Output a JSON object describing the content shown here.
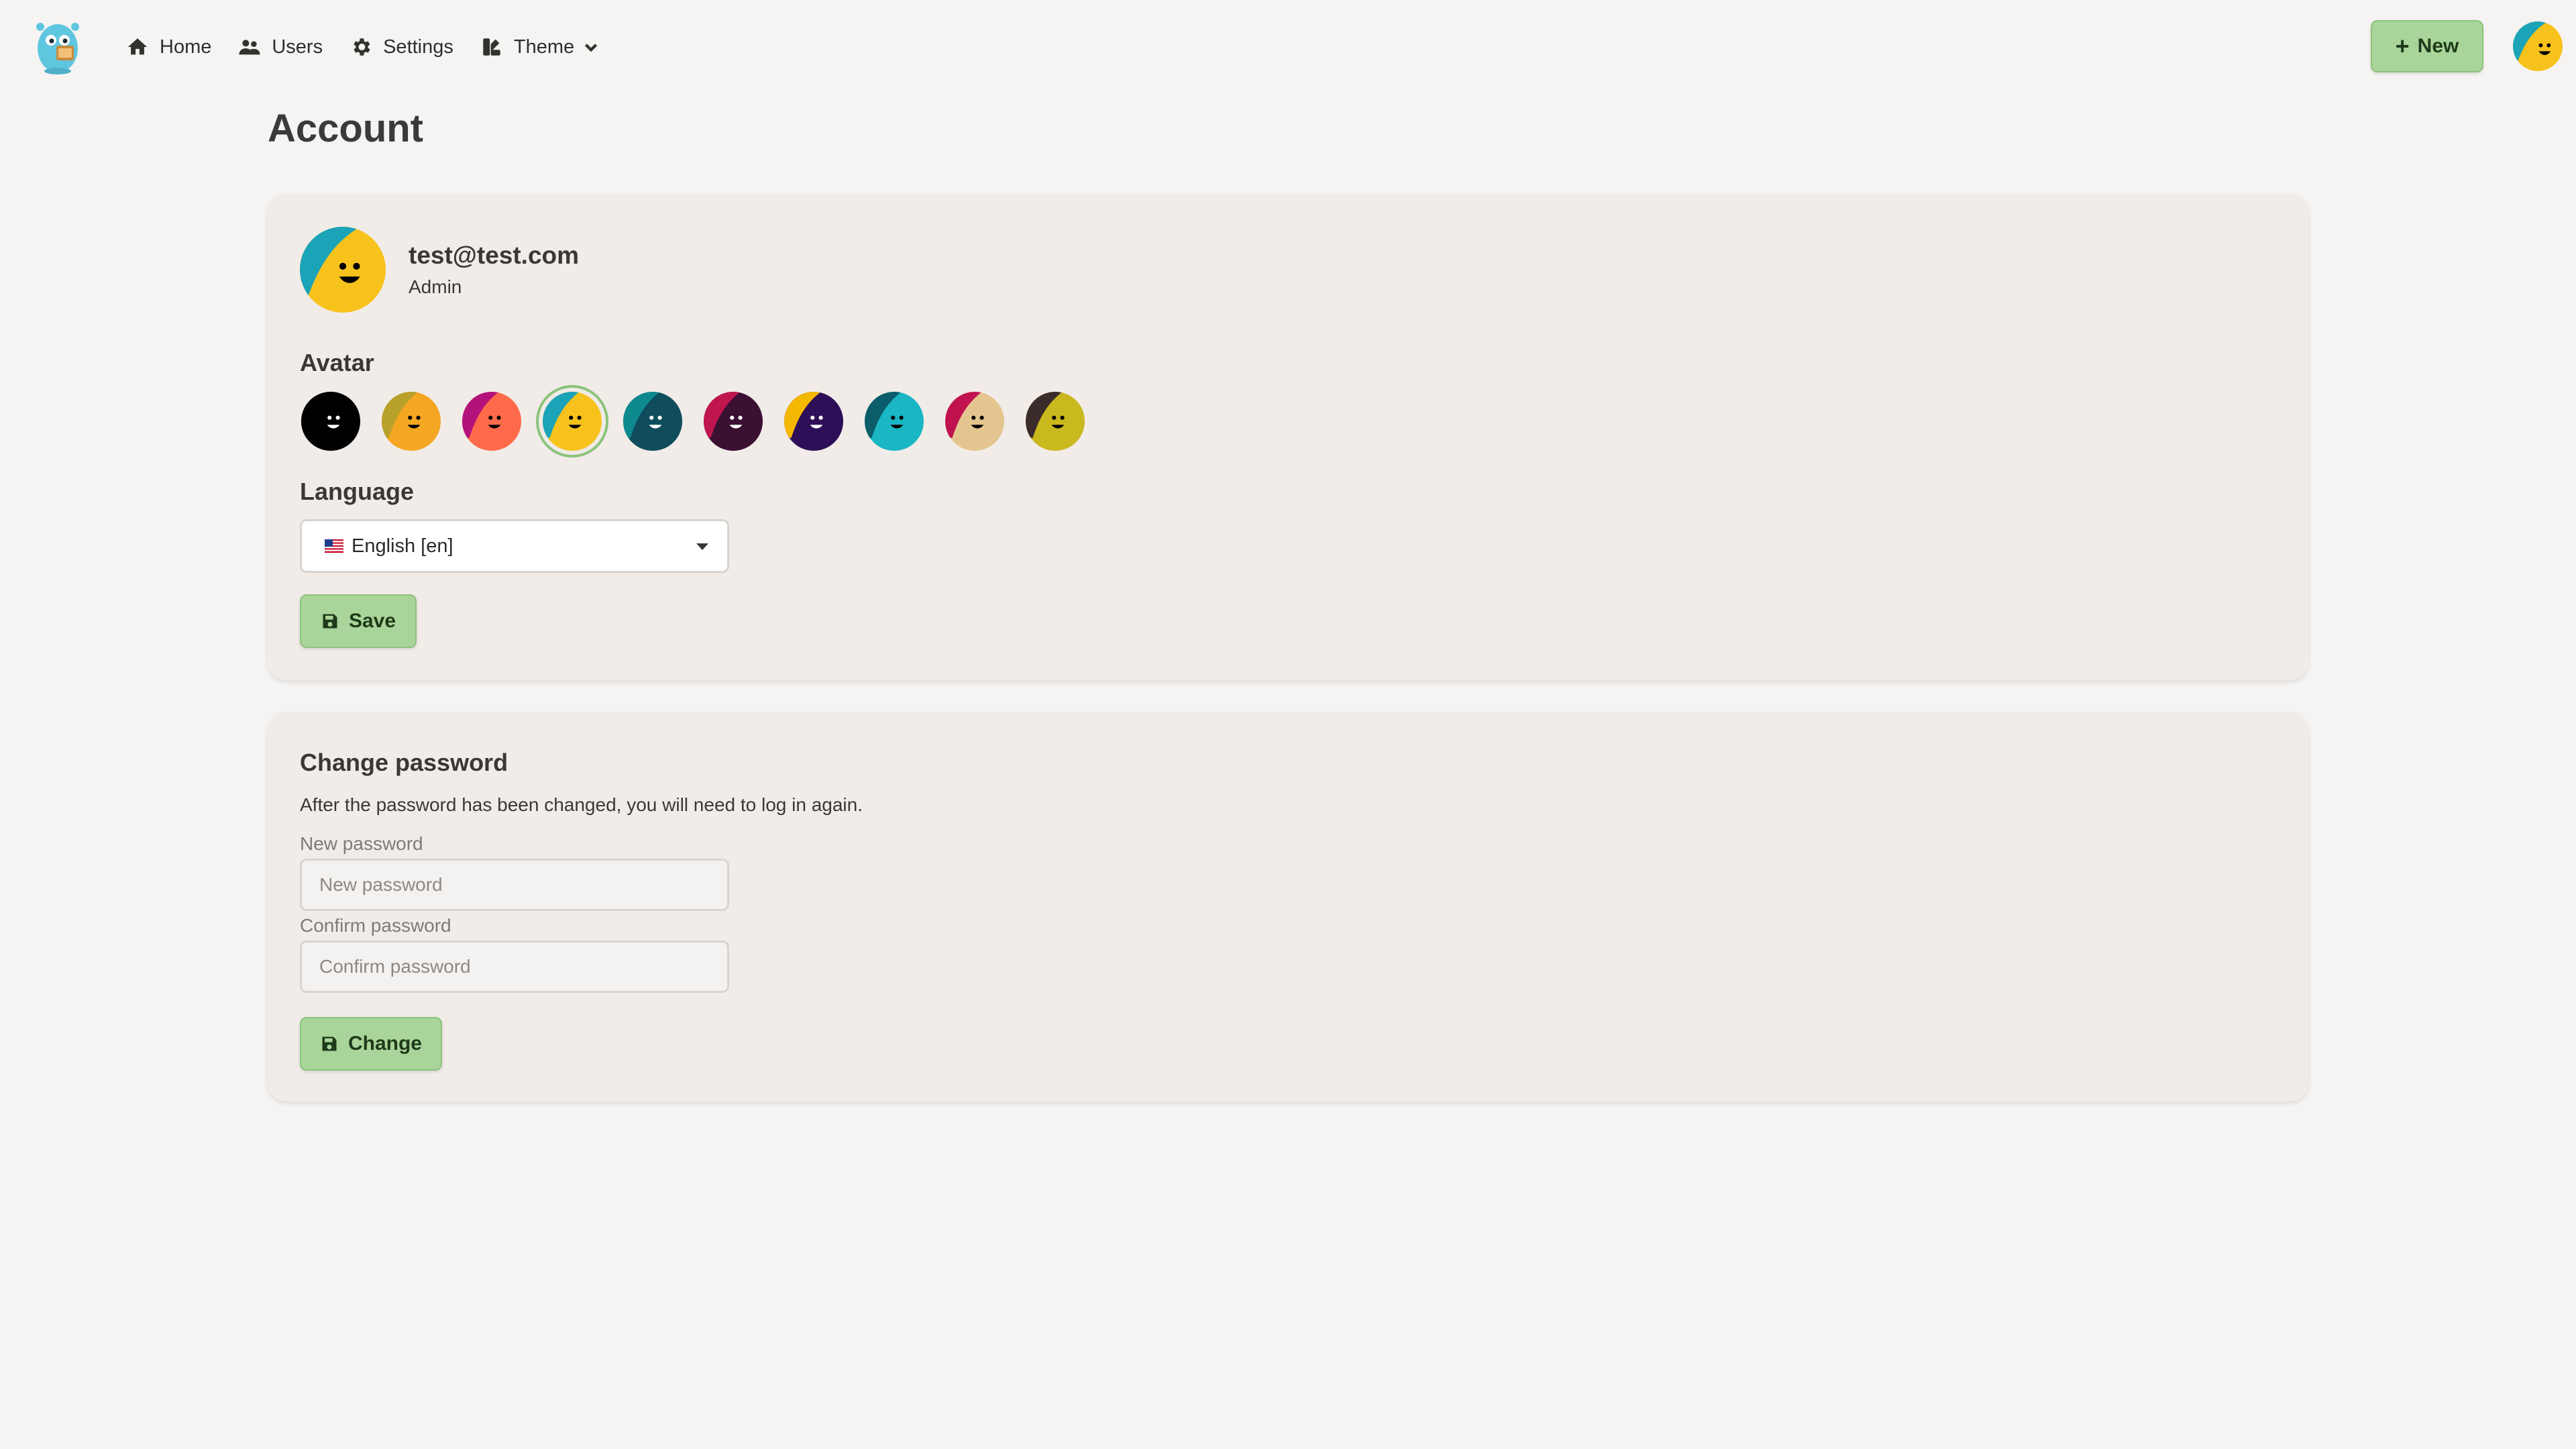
{
  "nav": {
    "home_label": "Home",
    "users_label": "Users",
    "settings_label": "Settings",
    "theme_label": "Theme",
    "new_label": "New"
  },
  "page": {
    "title": "Account"
  },
  "profile": {
    "email": "test@test.com",
    "role": "Admin",
    "avatar_label": "Avatar",
    "avatar_options": [
      {
        "bg": "#000000",
        "accent": "#000000",
        "face": "#000000",
        "eye": "#ffffff"
      },
      {
        "bg": "#f5a623",
        "accent": "#b8a12a",
        "face": "#f5a623",
        "eye": "#000000"
      },
      {
        "bg": "#ff6b4a",
        "accent": "#b3127a",
        "face": "#ff6b4a",
        "eye": "#000000"
      },
      {
        "bg": "#f8c21c",
        "accent": "#1ba3b8",
        "face": "#f8c21c",
        "eye": "#000000",
        "selected": true
      },
      {
        "bg": "#0f4d5c",
        "accent": "#0e8a8f",
        "face": "#0f4d5c",
        "eye": "#ffffff"
      },
      {
        "bg": "#3b1033",
        "accent": "#c0154f",
        "face": "#3b1033",
        "eye": "#ffffff"
      },
      {
        "bg": "#2e0f57",
        "accent": "#f5b800",
        "face": "#2e0f57",
        "eye": "#ffffff"
      },
      {
        "bg": "#1ab6c4",
        "accent": "#0b5d6b",
        "face": "#1ab6c4",
        "eye": "#000000"
      },
      {
        "bg": "#e4c58f",
        "accent": "#c0124f",
        "face": "#e4c58f",
        "eye": "#000000"
      },
      {
        "bg": "#c9b81e",
        "accent": "#3a2c2a",
        "face": "#c9b81e",
        "eye": "#000000"
      }
    ],
    "language_label": "Language",
    "language_value": "English [en]",
    "save_label": "Save"
  },
  "password": {
    "title": "Change password",
    "description": "After the password has been changed, you will need to log in again.",
    "new_label": "New password",
    "new_placeholder": "New password",
    "confirm_label": "Confirm password",
    "confirm_placeholder": "Confirm password",
    "change_label": "Change"
  },
  "colors": {
    "accent_green": "#a9d59a",
    "page_bg": "#f6f4f2",
    "card_bg": "#f1ece8"
  }
}
